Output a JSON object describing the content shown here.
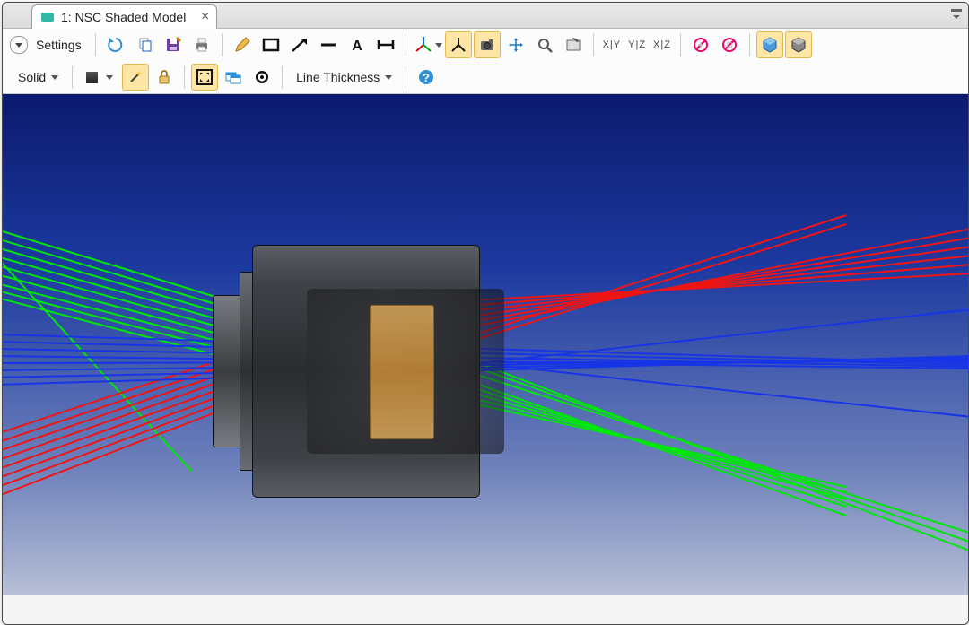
{
  "tab": {
    "title": "1: NSC Shaded Model"
  },
  "toolbar": {
    "settings": "Settings",
    "solid": "Solid",
    "line_thickness": "Line Thickness",
    "axis_xy": "X|Y",
    "axis_yz": "Y|Z",
    "axis_xz": "X|Z"
  },
  "icons": {
    "refresh": "refresh-icon",
    "copy": "copy-icon",
    "save": "save-icon",
    "print": "print-icon",
    "pencil": "pencil-icon",
    "rectangle": "rectangle-icon",
    "arrow": "arrow-icon",
    "line": "line-icon",
    "text": "text-icon",
    "dimension": "dimension-icon",
    "axes3d": "axes-3d-icon",
    "axesflat": "axes-flat-icon",
    "camera": "camera-icon",
    "pan": "pan-icon",
    "zoom": "zoom-icon",
    "reset": "reset-view-icon",
    "nomeas1": "no-measure-icon",
    "nomeas2": "no-measure-alt-icon",
    "cube1": "shading-solid-icon",
    "cube2": "shading-wire-icon",
    "wand": "magic-wand-icon",
    "lock": "lock-icon",
    "fit": "fit-window-icon",
    "windows": "windows-icon",
    "target": "target-icon",
    "help": "help-icon"
  }
}
